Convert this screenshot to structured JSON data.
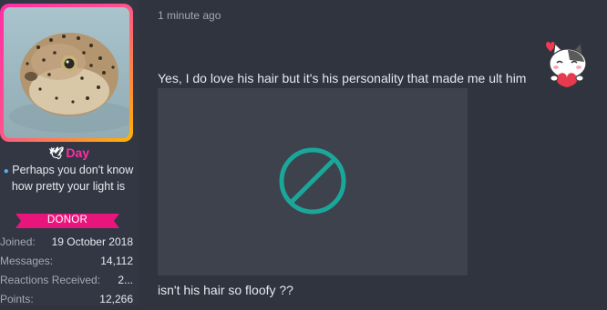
{
  "user": {
    "name": "Day",
    "title": "Perhaps you don't know how pretty your light is",
    "badge": "DONOR",
    "stats": [
      {
        "label": "Joined:",
        "value": "19 October 2018"
      },
      {
        "label": "Messages:",
        "value": "14,112"
      },
      {
        "label": "Reactions Received:",
        "value": "2..."
      },
      {
        "label": "Points:",
        "value": "12,266"
      }
    ]
  },
  "post": {
    "timestamp": "1 minute ago",
    "message_1": "Yes, I do love his hair but it's his personality that made me ult him",
    "message_2": "isn't his hair so floofy ??"
  },
  "icons": {
    "name_prefix": "dove-icon",
    "title_prefix": "fish-icon",
    "sticker": "cat-heart-sticker",
    "broken_image": "prohibited-icon"
  },
  "colors": {
    "username": "#ff2da6",
    "badge": "#e8157d",
    "prohibited": "#1aa79a"
  }
}
